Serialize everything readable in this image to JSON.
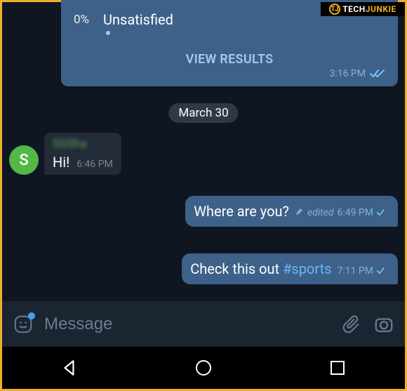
{
  "watermark": {
    "logo_text": "TJ",
    "part1": "TECH",
    "part2": "JUNKIE"
  },
  "poll": {
    "option_pct": "0%",
    "option_label": "Unsatisfied",
    "view_label": "VIEW RESULTS",
    "time": "3:16 PM"
  },
  "date_divider": "March 30",
  "incoming": {
    "avatar_letter": "S",
    "sender_name": "SSSha",
    "text": "Hi!",
    "time": "6:46 PM"
  },
  "outgoing1": {
    "text": "Where are you?",
    "edited_label": "edited",
    "time": "6:49 PM"
  },
  "outgoing2": {
    "text_prefix": "Check this out ",
    "hashtag": "#sports",
    "time": "7:11 PM"
  },
  "input": {
    "placeholder": "Message"
  }
}
